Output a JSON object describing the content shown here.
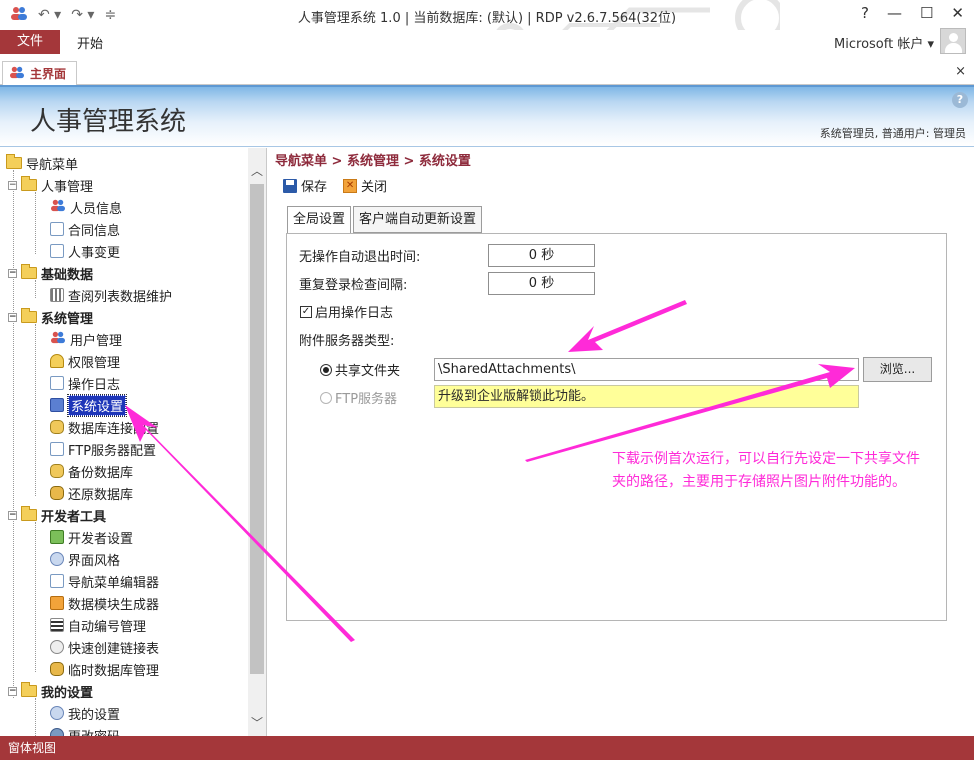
{
  "window": {
    "title": "人事管理系统 1.0 | 当前数据库: (默认) | RDP v2.6.7.564(32位)",
    "controls": [
      "?",
      "—",
      "☐",
      "✕"
    ]
  },
  "ribbon": {
    "file_tab": "文件",
    "start_tab": "开始",
    "account": "Microsoft 帐户 ▾"
  },
  "doc_tab": {
    "label": "主界面",
    "close": "×"
  },
  "banner": {
    "app_name": "人事管理系统",
    "user_info": "系统管理员, 普通用户: 管理员",
    "help": "?"
  },
  "nav": {
    "root": "导航菜单",
    "groups": [
      {
        "label": "人事管理",
        "items": [
          "人员信息",
          "合同信息",
          "人事变更"
        ]
      },
      {
        "label": "基础数据",
        "items": [
          "查阅列表数据维护"
        ]
      },
      {
        "label": "系统管理",
        "items": [
          "用户管理",
          "权限管理",
          "操作日志",
          "系统设置",
          "数据库连接配置",
          "FTP服务器配置",
          "备份数据库",
          "还原数据库"
        ]
      },
      {
        "label": "开发者工具",
        "items": [
          "开发者设置",
          "界面风格",
          "导航菜单编辑器",
          "数据模块生成器",
          "自动编号管理",
          "快速创建链接表",
          "临时数据库管理"
        ]
      },
      {
        "label": "我的设置",
        "items": [
          "我的设置",
          "更改密码"
        ]
      }
    ],
    "selected": "系统设置"
  },
  "main": {
    "breadcrumb": "导航菜单 > 系统管理 > 系统设置",
    "toolbar": {
      "save": "保存",
      "close": "关闭"
    },
    "tabs": [
      "全局设置",
      "客户端自动更新设置"
    ],
    "settings": {
      "idle_logout_label": "无操作自动退出时间:",
      "idle_logout_value": "0 秒",
      "relogin_check_label": "重复登录检查间隔:",
      "relogin_check_value": "0 秒",
      "op_log_label": "启用操作日志",
      "op_log_checked": true,
      "attach_type_label": "附件服务器类型:",
      "shared_folder_label": "共享文件夹",
      "shared_folder_path": "\\SharedAttachments\\",
      "browse_label": "浏览...",
      "ftp_label": "FTP服务器",
      "upgrade_note": "升级到企业版解锁此功能。"
    }
  },
  "annotation": {
    "line1": "下载示例首次运行，可以自行先设定一下共享文件",
    "line2": "夹的路径，主要用于存储照片图片附件功能的。",
    "color": "#ff2ad8"
  },
  "statusbar": {
    "text": "窗体视图"
  }
}
